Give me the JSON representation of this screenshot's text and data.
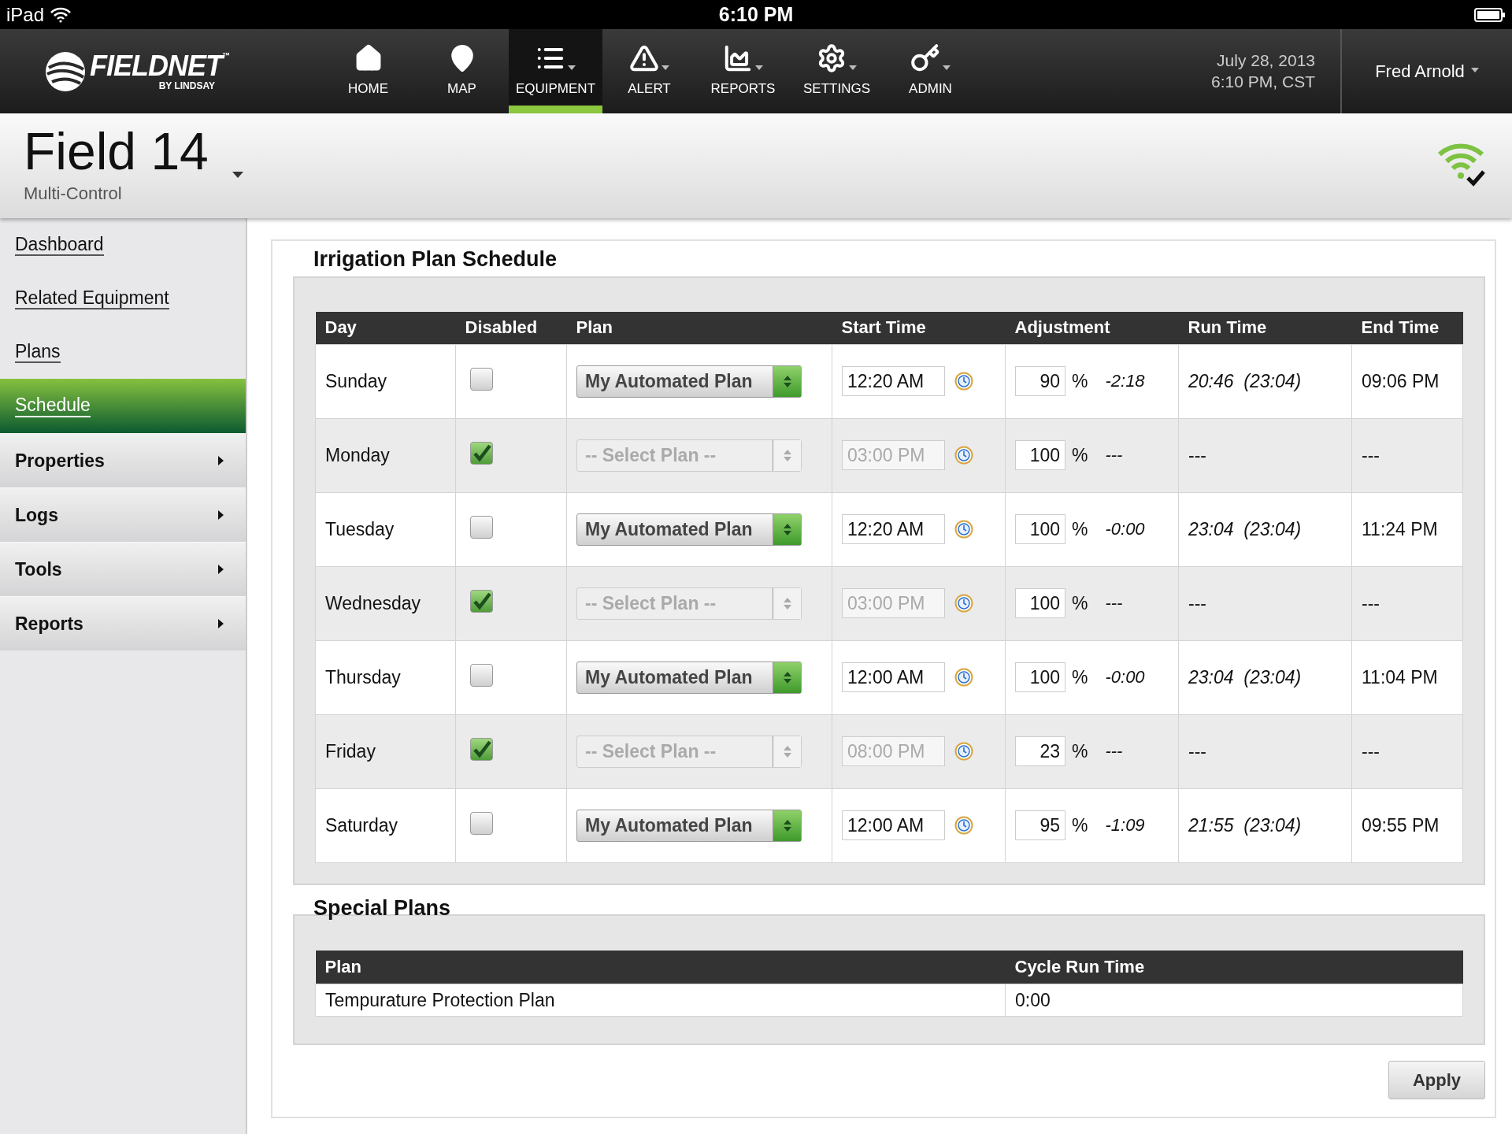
{
  "status_bar": {
    "device": "iPad",
    "time": "6:10 PM"
  },
  "nav": {
    "logo": {
      "name": "FIELDNET",
      "mark": "™",
      "byline": "BY LINDSAY"
    },
    "items": [
      {
        "label": "HOME",
        "kind": "home",
        "menu": false,
        "selected": false
      },
      {
        "label": "MAP",
        "kind": "pin",
        "menu": false,
        "selected": false
      },
      {
        "label": "EQUIPMENT",
        "kind": "list",
        "menu": true,
        "selected": true
      },
      {
        "label": "ALERT",
        "kind": "alert",
        "menu": true,
        "selected": false
      },
      {
        "label": "REPORTS",
        "kind": "chart",
        "menu": true,
        "selected": false
      },
      {
        "label": "SETTINGS",
        "kind": "gear",
        "menu": true,
        "selected": false
      },
      {
        "label": "ADMIN",
        "kind": "key",
        "menu": true,
        "selected": false
      }
    ],
    "date": "July 28, 2013",
    "time": "6:10 PM, CST",
    "user": "Fred Arnold"
  },
  "field": {
    "title": "Field 14",
    "subtitle": "Multi-Control"
  },
  "sidebar": {
    "items": [
      {
        "label": "Dashboard",
        "kind": "link",
        "selected": false
      },
      {
        "label": "Related Equipment",
        "kind": "link",
        "selected": false
      },
      {
        "label": "Plans",
        "kind": "link",
        "selected": false
      },
      {
        "label": "Schedule",
        "kind": "link",
        "selected": true
      },
      {
        "label": "Properties",
        "kind": "section",
        "selected": false
      },
      {
        "label": "Logs",
        "kind": "section",
        "selected": false
      },
      {
        "label": "Tools",
        "kind": "section",
        "selected": false
      },
      {
        "label": "Reports",
        "kind": "section",
        "selected": false
      }
    ]
  },
  "schedule": {
    "title": "Irrigation Plan Schedule",
    "columns": [
      "Day",
      "Disabled",
      "Plan",
      "Start Time",
      "Adjustment",
      "Run Time",
      "End Time"
    ],
    "rows": [
      {
        "day": "Sunday",
        "disabled": false,
        "plan": "My Automated Plan",
        "start_time": "12:20 AM",
        "adjustment": "90",
        "unit": "%",
        "offset": "-2:18",
        "run_time": "20:46  (23:04)",
        "end_time": "09:06 PM"
      },
      {
        "day": "Monday",
        "disabled": true,
        "plan": "-- Select Plan --",
        "start_time": "03:00 PM",
        "adjustment": "100",
        "unit": "%",
        "offset": "---",
        "run_time": "---",
        "end_time": "---"
      },
      {
        "day": "Tuesday",
        "disabled": false,
        "plan": "My Automated Plan",
        "start_time": "12:20 AM",
        "adjustment": "100",
        "unit": "%",
        "offset": "-0:00",
        "run_time": "23:04  (23:04)",
        "end_time": "11:24 PM"
      },
      {
        "day": "Wednesday",
        "disabled": true,
        "plan": "-- Select Plan --",
        "start_time": "03:00 PM",
        "adjustment": "100",
        "unit": "%",
        "offset": "---",
        "run_time": "---",
        "end_time": "---"
      },
      {
        "day": "Thursday",
        "disabled": false,
        "plan": "My Automated Plan",
        "start_time": "12:00 AM",
        "adjustment": "100",
        "unit": "%",
        "offset": "-0:00",
        "run_time": "23:04  (23:04)",
        "end_time": "11:04 PM"
      },
      {
        "day": "Friday",
        "disabled": true,
        "plan": "-- Select Plan --",
        "start_time": "08:00 PM",
        "adjustment": "23",
        "unit": "%",
        "offset": "---",
        "run_time": "---",
        "end_time": "---"
      },
      {
        "day": "Saturday",
        "disabled": false,
        "plan": "My Automated Plan",
        "start_time": "12:00 AM",
        "adjustment": "95",
        "unit": "%",
        "offset": "-1:09",
        "run_time": "21:55  (23:04)",
        "end_time": "09:55 PM"
      }
    ]
  },
  "special_plans": {
    "title": "Special Plans",
    "columns": [
      "Plan",
      "Cycle Run Time"
    ],
    "rows": [
      {
        "plan": "Tempurature Protection Plan",
        "cycle_run_time": "0:00"
      }
    ]
  },
  "apply": "Apply"
}
